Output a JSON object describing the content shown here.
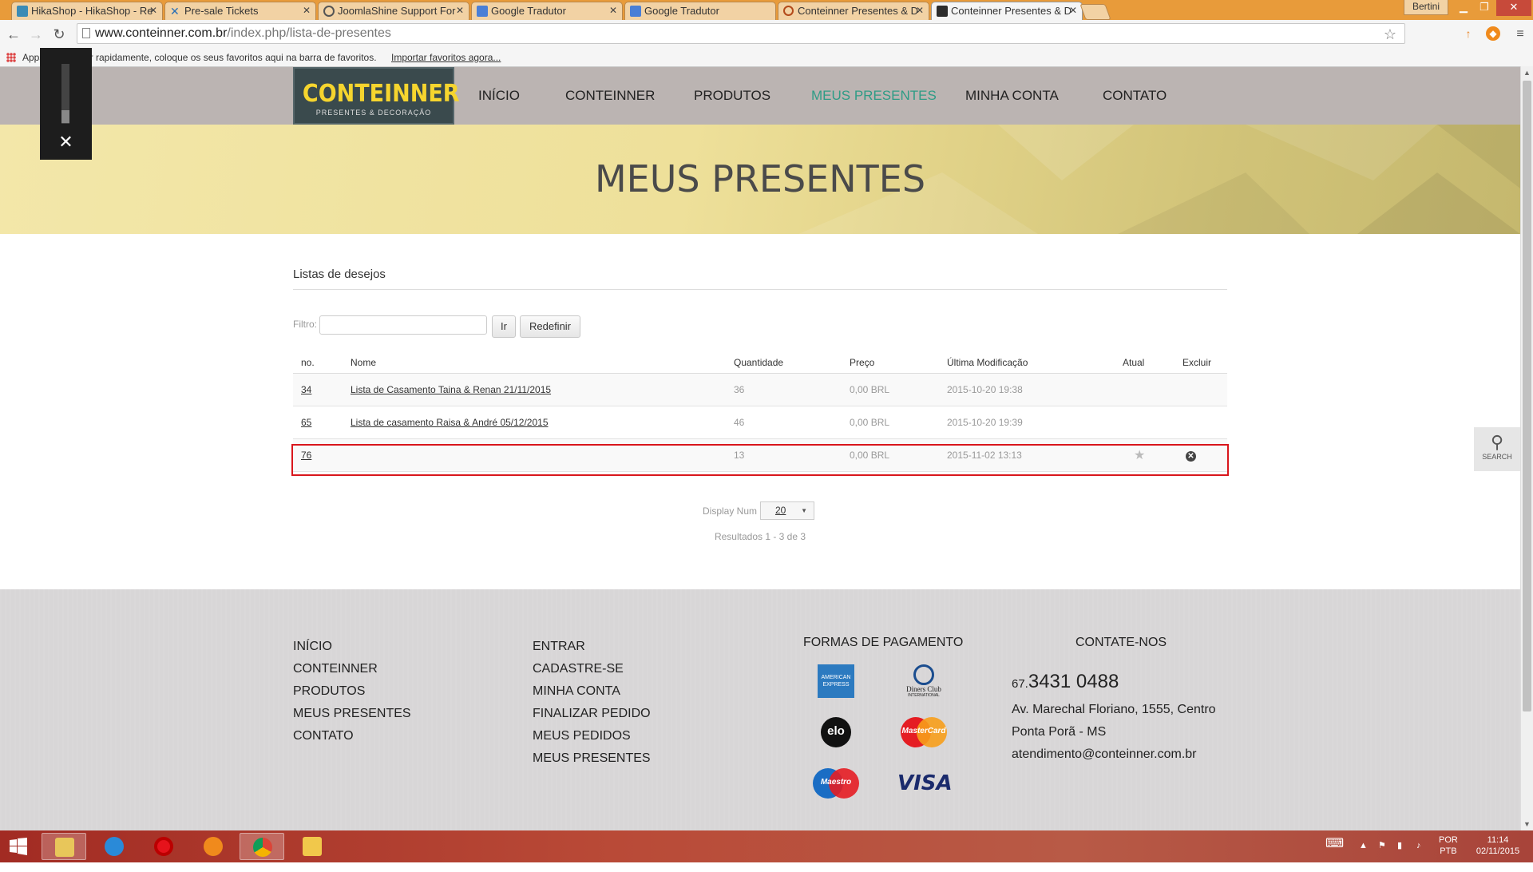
{
  "browser": {
    "tabs": [
      {
        "label": "HikaShop - HikaShop - Re",
        "icon_color": "#3c8bb5"
      },
      {
        "label": "Pre-sale Tickets",
        "icon_color": "#2a6fb5"
      },
      {
        "label": "JoomlaShine Support For",
        "icon_color": "#555555"
      },
      {
        "label": "Google Tradutor",
        "icon_color": "#4a7fd6"
      },
      {
        "label": "Google Tradutor",
        "icon_color": "#4a7fd6"
      },
      {
        "label": "Conteinner Presentes & D",
        "icon_color": "#b34a1a"
      },
      {
        "label": "Conteinner Presentes & D",
        "icon_color": "#2d2d2d"
      }
    ],
    "user": "Bertini",
    "url_domain": "www.conteinner.com.br",
    "url_path": "/index.php/lista-de-presentes",
    "bookmarks_apps": "Apps",
    "bookmarks_hint": "ssar rapidamente, coloque os seus favoritos aqui na barra de favoritos.",
    "bookmarks_import": "Importar favoritos agora..."
  },
  "site": {
    "logo_name": "CONTEINNER",
    "logo_tag": "PRESENTES & DECORAÇÃO",
    "nav": [
      "INÍCIO",
      "CONTEINNER",
      "PRODUTOS",
      "MEUS PRESENTES",
      "MINHA CONTA",
      "CONTATO"
    ],
    "active_nav": "MEUS PRESENTES",
    "accent_color": "#2f9c86",
    "page_heading": "MEUS PRESENTES"
  },
  "wishlist": {
    "title": "Listas de desejos",
    "filter_label": "Filtro:",
    "filter_value": "",
    "go_label": "Ir",
    "reset_label": "Redefinir",
    "columns": [
      "no.",
      "Nome",
      "Quantidade",
      "Preço",
      "Última Modificação",
      "Atual",
      "Excluir"
    ],
    "rows": [
      {
        "no": "34",
        "name": "Lista de Casamento Taina & Renan 21/11/2015",
        "qty": "36",
        "price": "0,00 BRL",
        "modified": "2015-10-20 19:38",
        "current": false,
        "deletable": false
      },
      {
        "no": "65",
        "name": "Lista de casamento Raisa & André 05/12/2015",
        "qty": "46",
        "price": "0,00 BRL",
        "modified": "2015-10-20 19:39",
        "current": false,
        "deletable": false
      },
      {
        "no": "76",
        "name": "",
        "qty": "13",
        "price": "0,00 BRL",
        "modified": "2015-11-02 13:13",
        "current": true,
        "deletable": true
      }
    ],
    "highlight_color": "#d9161c",
    "display_num_label": "Display Num",
    "display_num_value": "20",
    "results_text": "Resultados 1 - 3 de 3"
  },
  "search_side_label": "SEARCH",
  "footer": {
    "col1": [
      "INÍCIO",
      "CONTEINNER",
      "PRODUTOS",
      "MEUS PRESENTES",
      "CONTATO"
    ],
    "col2": [
      "ENTRAR",
      "CADASTRE-SE",
      "MINHA CONTA",
      "FINALIZAR PEDIDO",
      "MEUS PEDIDOS",
      "MEUS PRESENTES"
    ],
    "payments_title": "FORMAS DE PAGAMENTO",
    "payments": [
      "American Express",
      "Diners Club International",
      "elo",
      "MasterCard",
      "Maestro",
      "VISA"
    ],
    "contact_title": "CONTATE-NOS",
    "phone_prefix": "67.",
    "phone": "3431 0488",
    "address1": "Av. Marechal Floriano, 1555, Centro",
    "address2": "Ponta Porã - MS",
    "email": "atendimento@conteinner.com.br"
  },
  "taskbar": {
    "lang1": "POR",
    "lang2": "PTB",
    "time": "11:14",
    "date": "02/11/2015"
  }
}
